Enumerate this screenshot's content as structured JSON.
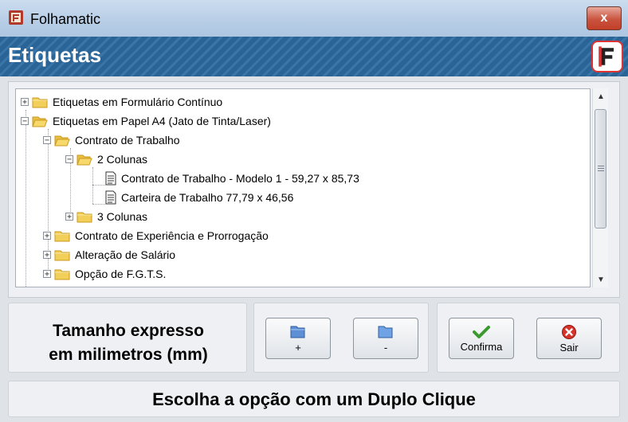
{
  "window": {
    "title": "Folhamatic",
    "close_label": "x"
  },
  "header": {
    "title": "Etiquetas"
  },
  "tree": {
    "items": [
      {
        "label": "Etiquetas em Formulário Contínuo",
        "expander": "+"
      },
      {
        "label": "Etiquetas em Papel A4 (Jato de Tinta/Laser)",
        "expander": "−"
      },
      {
        "label": "Contrato de Trabalho",
        "expander": "−"
      },
      {
        "label": "2 Colunas",
        "expander": "−"
      },
      {
        "label": "Contrato de Trabalho - Modelo 1 - 59,27 x 85,73"
      },
      {
        "label": "Carteira de Trabalho 77,79 x 46,56"
      },
      {
        "label": "3 Colunas",
        "expander": "+"
      },
      {
        "label": "Contrato de Experiência e Prorrogação",
        "expander": "+"
      },
      {
        "label": "Alteração de Salário",
        "expander": "+"
      },
      {
        "label": "Opção de F.G.T.S.",
        "expander": "+"
      }
    ]
  },
  "size_info": {
    "line1": "Tamanho expresso",
    "line2": "em milimetros (mm)"
  },
  "buttons": {
    "expand_label": "+",
    "collapse_label": "-",
    "confirm_label": "Confirma",
    "exit_label": "Sair"
  },
  "hint": {
    "text": "Escolha a opção com um Duplo Clique"
  },
  "colors": {
    "header_blue": "#2a6496",
    "title_bar": "#b7cde6",
    "close_red": "#c94a35",
    "folder_yellow": "#f2cf58"
  }
}
